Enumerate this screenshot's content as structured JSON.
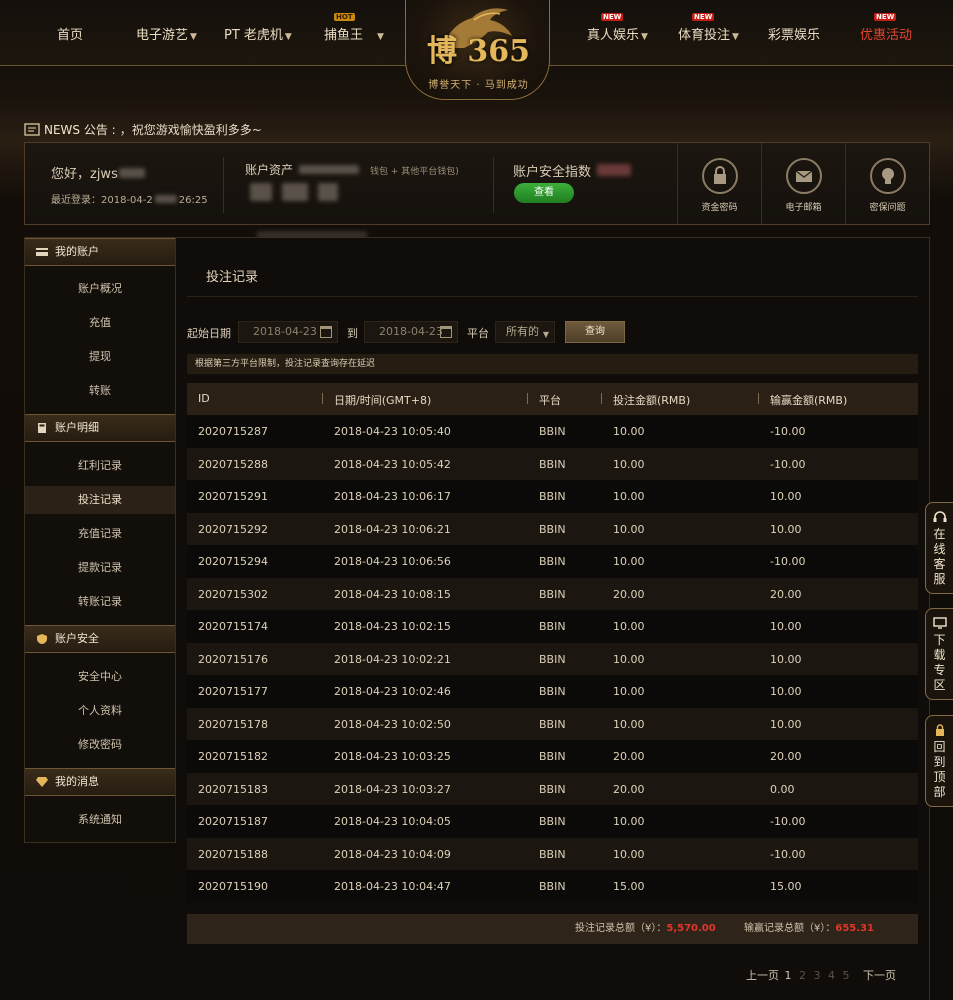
{
  "nav": {
    "left": [
      {
        "label": "首页",
        "chevron": false,
        "badge": ""
      },
      {
        "label": "电子游艺",
        "chevron": true,
        "badge": ""
      },
      {
        "label": "PT 老虎机",
        "chevron": true,
        "badge": ""
      },
      {
        "label": "捕鱼王",
        "chevron": true,
        "badge": "HOT"
      }
    ],
    "right": [
      {
        "label": "真人娱乐",
        "chevron": true,
        "badge": "NEW"
      },
      {
        "label": "体育投注",
        "chevron": true,
        "badge": "NEW"
      },
      {
        "label": "彩票娱乐",
        "chevron": false,
        "badge": ""
      },
      {
        "label": "优惠活动",
        "chevron": false,
        "badge": "NEW"
      }
    ]
  },
  "logo": {
    "main": "博 365",
    "slogan": "博誉天下 · 马到成功"
  },
  "news": {
    "label": "NEWS 公告 :",
    "text": "，祝您游戏愉快盈利多多~"
  },
  "account": {
    "greeting": "您好，zjws",
    "last_login": "最近登录：2018-04-2",
    "last_login_tail": "26:25",
    "balance_label": "账户资产",
    "balance_note": "钱包 + 其他平台钱包)",
    "security_label": "账户安全指数",
    "view_button": "查看",
    "quick": [
      {
        "label": "资金密码",
        "icon": "lock-icon"
      },
      {
        "label": "电子邮箱",
        "icon": "mail-icon"
      },
      {
        "label": "密保问题",
        "icon": "lightbulb-icon"
      }
    ]
  },
  "sidebar": {
    "sections": [
      {
        "title": "我的账户",
        "icon": "card-icon",
        "items": [
          "账户概况",
          "充值",
          "提现",
          "转账"
        ]
      },
      {
        "title": "账户明细",
        "icon": "calculator-icon",
        "items": [
          "红利记录",
          "投注记录",
          "充值记录",
          "提款记录",
          "转账记录"
        ]
      },
      {
        "title": "账户安全",
        "icon": "shield-icon",
        "items": [
          "安全中心",
          "个人资料",
          "修改密码"
        ]
      },
      {
        "title": "我的消息",
        "icon": "diamond-icon",
        "items": [
          "系统通知"
        ]
      }
    ],
    "active": "投注记录"
  },
  "main": {
    "title": "投注记录",
    "filter": {
      "start_label": "起始日期",
      "start_value": "2018-04-23",
      "to_label": "到",
      "end_value": "2018-04-23",
      "platform_label": "平台",
      "platform_value": "所有的",
      "query_button": "查询"
    },
    "notice": "根据第三方平台限制，投注记录查询存在延迟",
    "columns": [
      "ID",
      "日期/时间(GMT+8)",
      "平台",
      "投注金额(RMB)",
      "输赢金额(RMB)"
    ],
    "rows": [
      [
        "2020715287",
        "2018-04-23 10:05:40",
        "BBIN",
        "10.00",
        "-10.00"
      ],
      [
        "2020715288",
        "2018-04-23 10:05:42",
        "BBIN",
        "10.00",
        "-10.00"
      ],
      [
        "2020715291",
        "2018-04-23 10:06:17",
        "BBIN",
        "10.00",
        "10.00"
      ],
      [
        "2020715292",
        "2018-04-23 10:06:21",
        "BBIN",
        "10.00",
        "10.00"
      ],
      [
        "2020715294",
        "2018-04-23 10:06:56",
        "BBIN",
        "10.00",
        "-10.00"
      ],
      [
        "2020715302",
        "2018-04-23 10:08:15",
        "BBIN",
        "20.00",
        "20.00"
      ],
      [
        "2020715174",
        "2018-04-23 10:02:15",
        "BBIN",
        "10.00",
        "10.00"
      ],
      [
        "2020715176",
        "2018-04-23 10:02:21",
        "BBIN",
        "10.00",
        "10.00"
      ],
      [
        "2020715177",
        "2018-04-23 10:02:46",
        "BBIN",
        "10.00",
        "10.00"
      ],
      [
        "2020715178",
        "2018-04-23 10:02:50",
        "BBIN",
        "10.00",
        "10.00"
      ],
      [
        "2020715182",
        "2018-04-23 10:03:25",
        "BBIN",
        "20.00",
        "20.00"
      ],
      [
        "2020715183",
        "2018-04-23 10:03:27",
        "BBIN",
        "20.00",
        "0.00"
      ],
      [
        "2020715187",
        "2018-04-23 10:04:05",
        "BBIN",
        "10.00",
        "-10.00"
      ],
      [
        "2020715188",
        "2018-04-23 10:04:09",
        "BBIN",
        "10.00",
        "-10.00"
      ],
      [
        "2020715190",
        "2018-04-23 10:04:47",
        "BBIN",
        "15.00",
        "15.00"
      ]
    ],
    "totals": {
      "bet_label": "投注记录总额（¥）：",
      "bet_value": "5,570.00",
      "win_label": "输赢记录总额（¥）：",
      "win_value": "655.31"
    },
    "pager": {
      "prev": "上一页",
      "pages": [
        "1",
        "2",
        "3",
        "4",
        "5"
      ],
      "current": "1",
      "next": "下一页"
    }
  },
  "float_tabs": [
    {
      "label": "在线客服",
      "icon": "headset-icon"
    },
    {
      "label": "下载专区",
      "icon": "monitor-icon"
    },
    {
      "label": "回到顶部",
      "icon": "lock-top-icon"
    }
  ],
  "colors": {
    "accent": "#e3b75a",
    "promo": "#e24532",
    "total_red": "#e0372a",
    "view_green": "#2a9a2a"
  }
}
